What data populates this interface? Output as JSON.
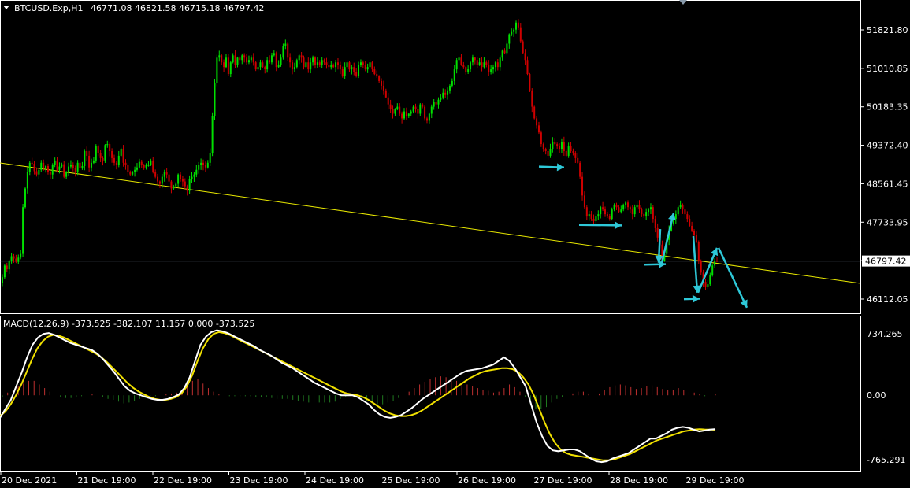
{
  "header": {
    "symbol": "BTCUSD.Exp,H1",
    "ohlc": "46771.08 46821.58 46715.18 46797.42",
    "dropdown_icon": "triangle-down-icon"
  },
  "colors": {
    "background": "#000000",
    "bull_candle": "#00e000",
    "bear_candle": "#d00000",
    "trendline": "#e8e800",
    "price_line": "#7d8fa6",
    "annotation_arrow": "#2ec8d8",
    "macd_line": "#ffffff",
    "signal_line": "#f0e000",
    "hist_positive": "#c03030",
    "hist_negative": "#207a20",
    "frame": "#ffffff"
  },
  "price_axis": {
    "ticks": [
      "51821.80",
      "51010.85",
      "50183.35",
      "49372.40",
      "48561.45",
      "47733.95",
      "46922.90",
      "46112.05"
    ],
    "current_label": "46797.42"
  },
  "time_axis": {
    "labels": [
      "20 Dec 2021",
      "21 Dec 19:00",
      "22 Dec 19:00",
      "23 Dec 19:00",
      "24 Dec 19:00",
      "25 Dec 19:00",
      "26 Dec 19:00",
      "27 Dec 19:00",
      "28 Dec 19:00",
      "29 Dec 19:00"
    ]
  },
  "macd_panel": {
    "header": "MACD(12,26,9) -373.525 -382.107 11.157 0.000 -373.525",
    "ticks": [
      "734.265",
      "0.00",
      "-765.291"
    ]
  },
  "chart_data": [
    {
      "type": "candlestick",
      "title": "BTCUSD.Exp,H1",
      "ylim": [
        45780,
        52250
      ],
      "x_start": "20 Dec 2021",
      "timeframe": "H1",
      "last_close": 46797.42,
      "close": [
        46450,
        46700,
        46620,
        46800,
        46900,
        46850,
        46780,
        46870,
        46950,
        47950,
        48350,
        48700,
        48900,
        48880,
        48720,
        48650,
        48750,
        48900,
        48780,
        48830,
        48700,
        48650,
        48850,
        48950,
        48750,
        48820,
        48870,
        48600,
        48700,
        48820,
        48850,
        48780,
        48700,
        48900,
        48780,
        48830,
        49150,
        49050,
        48800,
        48900,
        48950,
        49250,
        49100,
        49000,
        48950,
        49280,
        49300,
        49150,
        49000,
        48900,
        48850,
        49050,
        49200,
        48900,
        48850,
        48700,
        48650,
        48700,
        48750,
        48800,
        48920,
        48850,
        48800,
        48850,
        48850,
        48950,
        48700,
        48600,
        48500,
        48450,
        48600,
        48700,
        48650,
        48500,
        48350,
        48400,
        48450,
        48650,
        48550,
        48500,
        48400,
        48300,
        48550,
        48600,
        48650,
        48750,
        48850,
        48900,
        48850,
        48800,
        48900,
        49100,
        49900,
        50600,
        51150,
        51200,
        51050,
        50950,
        51150,
        50800,
        51050,
        51200,
        51000,
        51150,
        51100,
        51200,
        51150,
        51050,
        51100,
        51150,
        51050,
        50900,
        50950,
        51050,
        50950,
        50900,
        51100,
        51050,
        51200,
        51250,
        50950,
        51000,
        51150,
        51400,
        51450,
        51150,
        51050,
        50900,
        50950,
        51100,
        51200,
        51150,
        50950,
        51050,
        50900,
        51050,
        51150,
        51000,
        51050,
        51000,
        51100,
        51050,
        51000,
        50950,
        51000,
        50950,
        51050,
        51000,
        50900,
        50750,
        50950,
        51050,
        50900,
        50950,
        50850,
        50750,
        51000,
        51050,
        51000,
        50900,
        50950,
        51050,
        50900,
        50800,
        50750,
        50650,
        50550,
        50450,
        50300,
        50150,
        50050,
        49950,
        50050,
        50100,
        49950,
        49850,
        50000,
        49900,
        49950,
        50000,
        50100,
        50050,
        49950,
        50150,
        50100,
        49850,
        49800,
        49950,
        50100,
        50200,
        50150,
        50250,
        50300,
        50400,
        50350,
        50450,
        50550,
        50650,
        50900,
        51100,
        51150,
        51000,
        50950,
        50850,
        50900,
        51050,
        51150,
        51100,
        51000,
        51050,
        50950,
        51050,
        51000,
        50850,
        50900,
        50950,
        51050,
        50950,
        51150,
        51300,
        51250,
        51450,
        51650,
        51700,
        51750,
        51900,
        51800,
        51500,
        51250,
        51100,
        50800,
        50450,
        50100,
        49850,
        49700,
        49550,
        49300,
        49200,
        49150,
        49050,
        49200,
        49350,
        49300,
        49250,
        49200,
        49350,
        49150,
        49050,
        49250,
        49150,
        49100,
        49000,
        48900,
        48600,
        48200,
        47950,
        47750,
        47800,
        47700,
        47650,
        47750,
        47800,
        47950,
        47900,
        47800,
        47750,
        47700,
        47900,
        48000,
        47950,
        47850,
        47900,
        48000,
        48050,
        47950,
        47900,
        47800,
        47950,
        48000,
        47900,
        47800,
        47750,
        47850,
        47900,
        47950,
        47700,
        47500,
        47300,
        47150,
        46800,
        46950,
        47250,
        47450,
        47600,
        47700,
        47800,
        47950,
        48000,
        47900,
        47800,
        47700,
        47550,
        47450,
        47350,
        47200,
        46800,
        46550,
        46350,
        46250,
        46300,
        46500,
        46700,
        46800,
        46797.42
      ]
    },
    {
      "type": "line",
      "title": "MACD(12,26,9)",
      "values_header": [
        -373.525,
        -382.107,
        11.157,
        0.0,
        -373.525
      ],
      "ylim": [
        -765.291,
        734.265
      ],
      "series": [
        {
          "name": "MACD",
          "values": [
            -250,
            -150,
            -50,
            100,
            250,
            420,
            560,
            640,
            680,
            690,
            670,
            640,
            610,
            580,
            560,
            540,
            520,
            500,
            460,
            400,
            330,
            260,
            180,
            100,
            50,
            20,
            0,
            -20,
            -40,
            -50,
            -50,
            -40,
            -20,
            10,
            80,
            200,
            380,
            560,
            650,
            700,
            720,
            710,
            690,
            660,
            630,
            600,
            570,
            540,
            500,
            470,
            440,
            400,
            360,
            330,
            300,
            260,
            220,
            180,
            140,
            110,
            80,
            50,
            20,
            0,
            0,
            0,
            -20,
            -60,
            -100,
            -160,
            -210,
            -240,
            -250,
            -240,
            -220,
            -180,
            -140,
            -90,
            -40,
            0,
            40,
            80,
            120,
            160,
            200,
            240,
            270,
            280,
            290,
            300,
            320,
            340,
            380,
            420,
            380,
            300,
            200,
            100,
            -100,
            -300,
            -450,
            -560,
            -610,
            -620,
            -610,
            -600,
            -600,
            -620,
            -660,
            -700,
            -730,
            -740,
            -730,
            -700,
            -680,
            -660,
            -640,
            -600,
            -560,
            -520,
            -480,
            -480,
            -450,
            -420,
            -380,
            -360,
            -350,
            -360,
            -380,
            -400,
            -390,
            -380,
            -373.525
          ]
        },
        {
          "name": "Signal",
          "values": [
            -230,
            -180,
            -100,
            0,
            120,
            260,
            400,
            520,
            600,
            650,
            670,
            660,
            640,
            610,
            580,
            550,
            520,
            490,
            460,
            420,
            370,
            310,
            250,
            190,
            130,
            80,
            40,
            10,
            -20,
            -40,
            -50,
            -50,
            -40,
            -20,
            20,
            100,
            220,
            380,
            520,
            620,
            680,
            700,
            690,
            670,
            640,
            610,
            580,
            550,
            520,
            490,
            460,
            430,
            400,
            370,
            340,
            310,
            280,
            250,
            220,
            190,
            160,
            130,
            100,
            70,
            40,
            20,
            10,
            0,
            -20,
            -50,
            -90,
            -130,
            -170,
            -200,
            -220,
            -230,
            -230,
            -220,
            -200,
            -170,
            -130,
            -90,
            -50,
            -10,
            30,
            70,
            110,
            150,
            190,
            220,
            250,
            270,
            280,
            290,
            300,
            300,
            290,
            260,
            200,
            120,
            0,
            -150,
            -300,
            -430,
            -530,
            -600,
            -640,
            -660,
            -670,
            -680,
            -690,
            -700,
            -710,
            -720,
            -720,
            -710,
            -690,
            -670,
            -650,
            -620,
            -590,
            -560,
            -530,
            -500,
            -480,
            -460,
            -440,
            -420,
            -400,
            -390,
            -380,
            -375,
            -378,
            -380,
            -382.107
          ]
        },
        {
          "name": "Histogram",
          "values": [
            -20,
            30,
            50,
            100,
            130,
            160,
            160,
            120,
            80,
            40,
            0,
            -20,
            -30,
            -30,
            -20,
            -10,
            0,
            10,
            0,
            -20,
            -40,
            -50,
            -70,
            -90,
            -80,
            -60,
            -40,
            -30,
            -20,
            -10,
            0,
            10,
            20,
            30,
            60,
            100,
            160,
            180,
            130,
            80,
            40,
            10,
            0,
            -10,
            -10,
            -10,
            -10,
            -10,
            -20,
            -20,
            -20,
            -30,
            -40,
            -40,
            -40,
            -50,
            -60,
            -70,
            -80,
            -80,
            -80,
            -80,
            -80,
            -70,
            -40,
            -20,
            -10,
            -20,
            -40,
            -60,
            -80,
            -100,
            -100,
            -80,
            -60,
            -30,
            0,
            40,
            80,
            120,
            150,
            180,
            200,
            210,
            200,
            180,
            160,
            140,
            120,
            100,
            80,
            60,
            50,
            30,
            40,
            80,
            120,
            90,
            40,
            -20,
            -100,
            -150,
            -150,
            -130,
            -80,
            -40,
            -20,
            0,
            20,
            40,
            40,
            20,
            0,
            20,
            60,
            90,
            110,
            120,
            110,
            90,
            70,
            80,
            100,
            110,
            90,
            70,
            60,
            60,
            80,
            60,
            40,
            30,
            10,
            -10,
            0,
            11.157
          ]
        }
      ]
    }
  ]
}
